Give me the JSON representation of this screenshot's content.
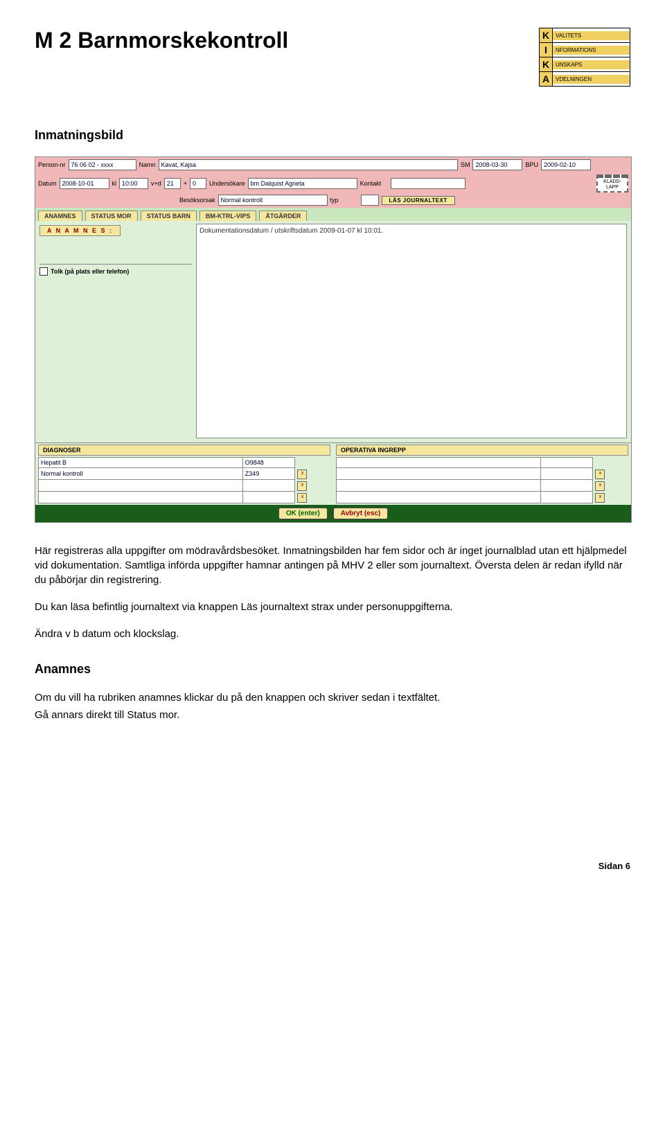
{
  "header": {
    "title": "M 2  Barnmorskekontroll",
    "kika": [
      {
        "letter": "K",
        "text": "VALITETS"
      },
      {
        "letter": "I",
        "text": "NFORMATIONS"
      },
      {
        "letter": "K",
        "text": "UNSKAPS"
      },
      {
        "letter": "A",
        "text": "VDELNINGEN"
      }
    ]
  },
  "section1_heading": "Inmatningsbild",
  "form": {
    "row1": {
      "personnr_lbl": "Person-nr",
      "personnr_val": "76 06 02 - xxxx",
      "namn_lbl": "Namn",
      "namn_val": "Kavat, Kajsa",
      "sm_lbl": "SM",
      "sm_val": "2008-03-30",
      "bpu_lbl": "BPU",
      "bpu_val": "2009-02-10"
    },
    "row2": {
      "datum_lbl": "Datum",
      "datum_val": "2008-10-01",
      "kl_lbl": "kl",
      "kl_val": "10:00",
      "vd_lbl": "v+d",
      "vd_v": "21",
      "plus": "+",
      "vd_d": "0",
      "undersokare_lbl": "Undersökare",
      "undersokare_val": "bm Dalquist Agneta",
      "besoksorsak_lbl": "Besöksorsak",
      "besoksorsak_val": "Normal kontroll",
      "kontakt_lbl": "Kontakt",
      "kontakt_val": "",
      "typ_lbl": "typ",
      "typ_val": "",
      "las_journaltext": "LÄS JOURNALTEXT",
      "kladd_lapp": "KLADD-LAPP"
    },
    "tabs": [
      "ANAMNES",
      "STATUS MOR",
      "STATUS BARN",
      "BM-KTRL-VIPS",
      "ÅTGÄRDER"
    ],
    "anamnes_btn": "A N A M N E S :",
    "tolk_label": "Tolk (på plats eller telefon)",
    "main_text": "Dokumentationsdatum / utskriftsdatum 2009-01-07 kl 10:01.",
    "diagnoser_header": "DIAGNOSER",
    "diagnoser_rows": [
      {
        "name": "Hepatit B",
        "code": "O9848"
      },
      {
        "name": "Normal kontroll",
        "code": "Z349"
      },
      {
        "name": "",
        "code": ""
      },
      {
        "name": "",
        "code": ""
      }
    ],
    "operativa_header": "OPERATIVA INGREPP",
    "operativa_rows": [
      {
        "name": "",
        "code": ""
      },
      {
        "name": "",
        "code": ""
      },
      {
        "name": "",
        "code": ""
      },
      {
        "name": "",
        "code": ""
      }
    ],
    "tiny_btn": "x",
    "footer": {
      "ok": "OK (enter)",
      "cancel": "Avbryt (esc)"
    }
  },
  "paragraphs": {
    "p1": "Här registreras alla uppgifter om mödravårdsbesöket. Inmatningsbilden har fem sidor och är inget journalblad utan ett hjälpmedel vid dokumentation. Samtliga införda uppgifter hamnar antingen på MHV 2 eller som journaltext. Översta delen är redan ifylld när du påbörjar din registrering.",
    "p2": "Du kan läsa befintlig journaltext via knappen Läs journaltext strax under personuppgifterna.",
    "p3": "Ändra v b datum och klockslag."
  },
  "section2_heading": "Anamnes",
  "paragraphs2": {
    "p4": "Om du vill ha rubriken anamnes klickar du på den knappen och skriver sedan i textfältet.",
    "p5": "Gå annars direkt till Status mor."
  },
  "footer_page": "Sidan 6"
}
